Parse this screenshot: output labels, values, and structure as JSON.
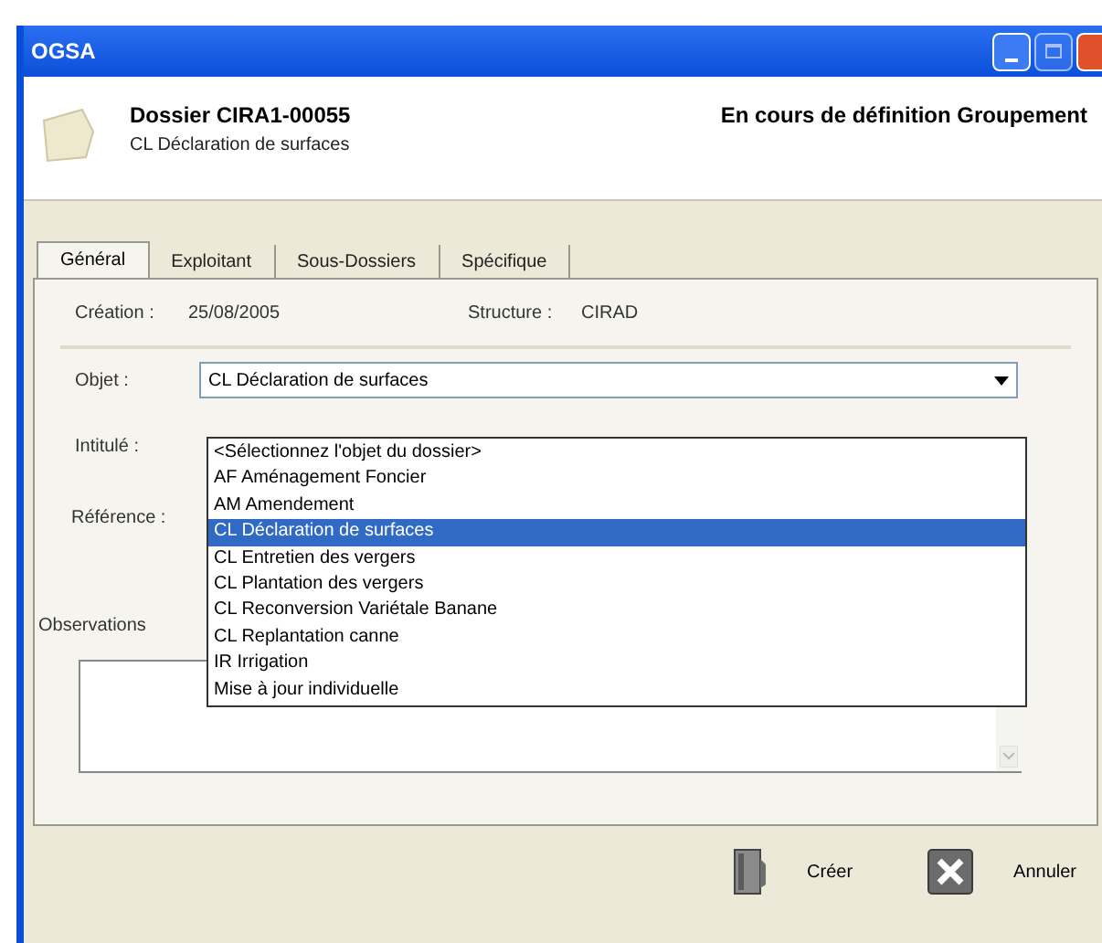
{
  "window": {
    "title": "OGSA"
  },
  "header": {
    "title": "Dossier CIRA1-00055",
    "subtitle": "CL Déclaration de surfaces",
    "status": "En cours de définition Groupement"
  },
  "tabs": [
    {
      "label": "Général",
      "selected": true
    },
    {
      "label": "Exploitant",
      "selected": false
    },
    {
      "label": "Sous-Dossiers",
      "selected": false
    },
    {
      "label": "Spécifique",
      "selected": false
    }
  ],
  "info": {
    "creation_label": "Création :",
    "creation_value": "25/08/2005",
    "structure_label": "Structure :",
    "structure_value": "CIRAD"
  },
  "objet": {
    "label": "Objet :",
    "value": "CL Déclaration de surfaces",
    "expanded": true,
    "options": [
      {
        "label": "<Sélectionnez l'objet du dossier>",
        "selected": false
      },
      {
        "label": "AF Aménagement Foncier",
        "selected": false
      },
      {
        "label": "AM Amendement",
        "selected": false
      },
      {
        "label": "CL Déclaration de surfaces",
        "selected": true
      },
      {
        "label": "CL Entretien des vergers",
        "selected": false
      },
      {
        "label": "CL Plantation des vergers",
        "selected": false
      },
      {
        "label": "CL Reconversion Variétale Banane",
        "selected": false
      },
      {
        "label": "CL Replantation canne",
        "selected": false
      },
      {
        "label": "IR Irrigation",
        "selected": false
      },
      {
        "label": "Mise à jour individuelle",
        "selected": false
      }
    ]
  },
  "intitule_label": "Intitulé :",
  "reference_label": "Référence :",
  "observations_label": "Observations",
  "buttons": [
    {
      "kind": "create",
      "label": "Créer"
    },
    {
      "kind": "cancel",
      "label": "Annuler"
    }
  ]
}
